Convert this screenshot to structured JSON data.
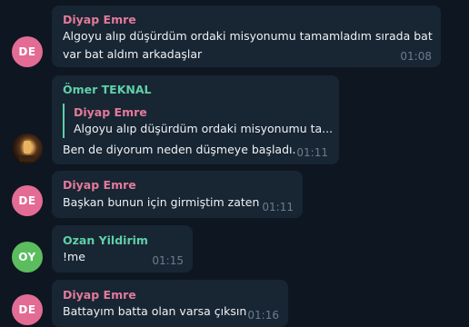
{
  "colors": {
    "background": "#0e1621",
    "bubble": "#182533",
    "pink_name": "#e37a9a",
    "green_name": "#5fd0a7",
    "avatar_pink": "#e36c94",
    "avatar_green": "#5bbd5e",
    "time": "#6c7c8c"
  },
  "messages": [
    {
      "avatar_initials": "DE",
      "sender": "Diyap Emre",
      "text_line1": "Algoyu alıp düşürdüm ordaki misyonumu tamamladım sırada bat",
      "text_line2": "var bat aldım arkadaşlar",
      "time": "01:08"
    },
    {
      "avatar_icon": "user-photo-avatar",
      "sender": "Ömer TEKNAL",
      "reply_to_sender": "Diyap Emre",
      "reply_to_text": "Algoyu alıp düşürdüm ordaki misyonumu ta...",
      "text": "Ben de diyorum neden düşmeye başladı.",
      "time": "01:11"
    },
    {
      "avatar_initials": "DE",
      "sender": "Diyap Emre",
      "text": "Başkan bunun için girmiştim zaten",
      "time": "01:11"
    },
    {
      "avatar_initials": "OY",
      "sender": "Ozan Yildirim",
      "text": "!me",
      "time": "01:15"
    },
    {
      "avatar_initials": "DE",
      "sender": "Diyap Emre",
      "text": "Battayım batta olan varsa çıksın",
      "time": "01:16"
    }
  ]
}
